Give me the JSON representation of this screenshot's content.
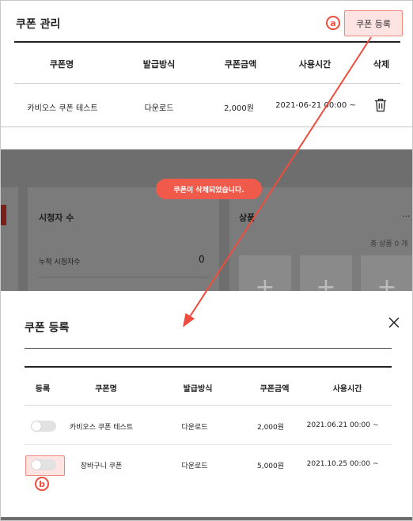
{
  "coupon_manager": {
    "title": "쿠폰 관리",
    "register_button": "쿠폰 등록",
    "marker": "a",
    "columns": [
      "쿠폰명",
      "발급방식",
      "쿠폰금액",
      "사용시간",
      "삭제"
    ],
    "row": {
      "name": "카비오스 쿠폰 테스트",
      "method": "다운로드",
      "amount": "2,000원",
      "period": "2021-06-21 00:00 ~",
      "delete_icon": "trash-icon"
    }
  },
  "background": {
    "toast": "쿠폰이 삭제되었습니다.",
    "viewers_card": {
      "title": "시청자 수",
      "metric_label": "누적 시청자수",
      "metric_value": "0"
    },
    "products_card": {
      "title": "상품",
      "more": "···",
      "total": "총 상품 0 개",
      "add_icon": "plus-icon"
    }
  },
  "modal": {
    "title": "쿠폰 등록",
    "close_icon": "close-icon",
    "columns": [
      "등록",
      "쿠폰명",
      "발급방식",
      "쿠폰금액",
      "사용시간"
    ],
    "rows": [
      {
        "enabled": false,
        "name": "카비오스 쿠폰 테스트",
        "method": "다운로드",
        "amount": "2,000원",
        "period": "2021.06.21 00:00 ~"
      },
      {
        "enabled": false,
        "name": "장바구니 쿠폰",
        "method": "다운로드",
        "amount": "5,000원",
        "period": "2021.10.25 00:00 ~"
      }
    ],
    "marker": "b"
  },
  "colors": {
    "accent": "#ef4c3c",
    "highlight_fill": "#fde3e1",
    "overlay": "#6e6e6e"
  }
}
